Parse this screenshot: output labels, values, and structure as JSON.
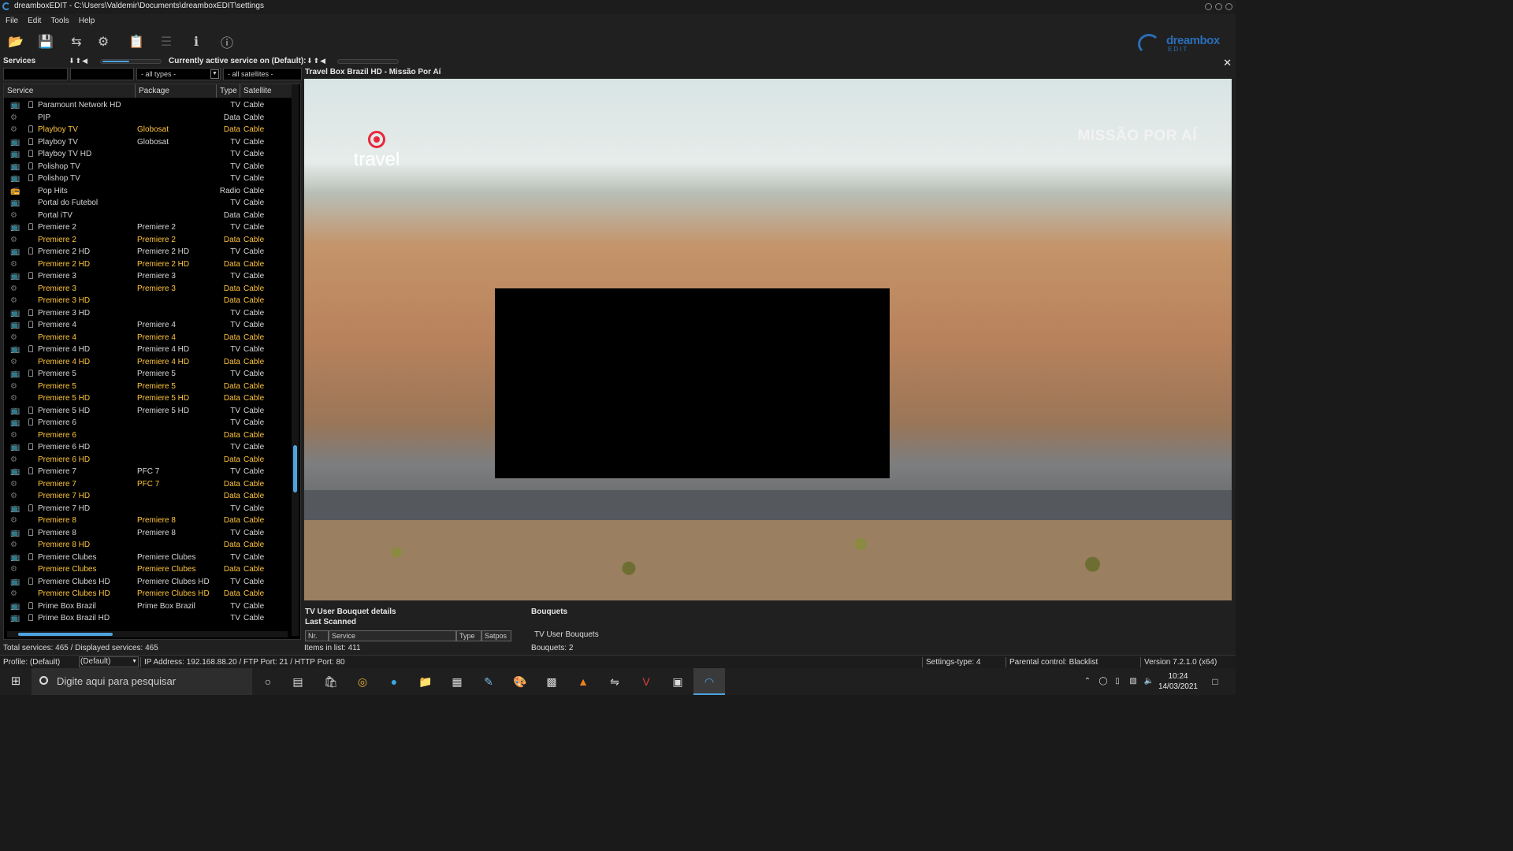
{
  "window": {
    "title": "dreamboxEDIT - C:\\Users\\Valdemir\\Documents\\dreamboxEDIT\\settings"
  },
  "menu": [
    "File",
    "Edit",
    "Tools",
    "Help"
  ],
  "brand": {
    "line1": "dreambox",
    "line2": "EDIT"
  },
  "services_panel": {
    "title": "Services",
    "active_label": "Currently active service on (Default):",
    "filter_types": "- all types -",
    "filter_sats": "- all satellites -",
    "columns": [
      "Service",
      "Package",
      "Type",
      "Satellite"
    ],
    "rows": [
      {
        "name": "Paramount Network HD",
        "package": "",
        "type": "TV",
        "satellite": "Cable",
        "hl": false,
        "lock": true,
        "icon": "tv"
      },
      {
        "name": "PIP",
        "package": "",
        "type": "Data",
        "satellite": "Cable",
        "hl": false,
        "lock": false,
        "icon": "data"
      },
      {
        "name": "Playboy TV",
        "package": "Globosat",
        "type": "Data",
        "satellite": "Cable",
        "hl": true,
        "lock": true,
        "icon": "data"
      },
      {
        "name": "Playboy TV",
        "package": "Globosat",
        "type": "TV",
        "satellite": "Cable",
        "hl": false,
        "lock": true,
        "icon": "tv"
      },
      {
        "name": "Playboy TV HD",
        "package": "",
        "type": "TV",
        "satellite": "Cable",
        "hl": false,
        "lock": true,
        "icon": "tv"
      },
      {
        "name": "Polishop TV",
        "package": "",
        "type": "TV",
        "satellite": "Cable",
        "hl": false,
        "lock": true,
        "icon": "tv"
      },
      {
        "name": "Polishop TV",
        "package": "",
        "type": "TV",
        "satellite": "Cable",
        "hl": false,
        "lock": true,
        "icon": "tv"
      },
      {
        "name": "Pop Hits",
        "package": "",
        "type": "Radio",
        "satellite": "Cable",
        "hl": false,
        "lock": false,
        "icon": "radio"
      },
      {
        "name": "Portal do Futebol",
        "package": "",
        "type": "TV",
        "satellite": "Cable",
        "hl": false,
        "lock": false,
        "icon": "tv"
      },
      {
        "name": "Portal iTV",
        "package": "",
        "type": "Data",
        "satellite": "Cable",
        "hl": false,
        "lock": false,
        "icon": "data"
      },
      {
        "name": "Premiere 2",
        "package": "Premiere 2",
        "type": "TV",
        "satellite": "Cable",
        "hl": false,
        "lock": true,
        "icon": "tv"
      },
      {
        "name": "Premiere 2",
        "package": "Premiere 2",
        "type": "Data",
        "satellite": "Cable",
        "hl": true,
        "lock": false,
        "icon": "data"
      },
      {
        "name": "Premiere 2 HD",
        "package": "Premiere 2 HD",
        "type": "TV",
        "satellite": "Cable",
        "hl": false,
        "lock": true,
        "icon": "tv"
      },
      {
        "name": "Premiere 2 HD",
        "package": "Premiere 2 HD",
        "type": "Data",
        "satellite": "Cable",
        "hl": true,
        "lock": false,
        "icon": "data"
      },
      {
        "name": "Premiere 3",
        "package": "Premiere 3",
        "type": "TV",
        "satellite": "Cable",
        "hl": false,
        "lock": true,
        "icon": "tv"
      },
      {
        "name": "Premiere 3",
        "package": "Premiere 3",
        "type": "Data",
        "satellite": "Cable",
        "hl": true,
        "lock": false,
        "icon": "data"
      },
      {
        "name": "Premiere 3 HD",
        "package": "",
        "type": "Data",
        "satellite": "Cable",
        "hl": true,
        "lock": false,
        "icon": "data"
      },
      {
        "name": "Premiere 3 HD",
        "package": "",
        "type": "TV",
        "satellite": "Cable",
        "hl": false,
        "lock": true,
        "icon": "tv"
      },
      {
        "name": "Premiere 4",
        "package": "Premiere 4",
        "type": "TV",
        "satellite": "Cable",
        "hl": false,
        "lock": true,
        "icon": "tv"
      },
      {
        "name": "Premiere 4",
        "package": "Premiere 4",
        "type": "Data",
        "satellite": "Cable",
        "hl": true,
        "lock": false,
        "icon": "data"
      },
      {
        "name": "Premiere 4 HD",
        "package": "Premiere 4 HD",
        "type": "TV",
        "satellite": "Cable",
        "hl": false,
        "lock": true,
        "icon": "tv"
      },
      {
        "name": "Premiere 4 HD",
        "package": "Premiere 4 HD",
        "type": "Data",
        "satellite": "Cable",
        "hl": true,
        "lock": false,
        "icon": "data"
      },
      {
        "name": "Premiere 5",
        "package": "Premiere 5",
        "type": "TV",
        "satellite": "Cable",
        "hl": false,
        "lock": true,
        "icon": "tv"
      },
      {
        "name": "Premiere 5",
        "package": "Premiere 5",
        "type": "Data",
        "satellite": "Cable",
        "hl": true,
        "lock": false,
        "icon": "data"
      },
      {
        "name": "Premiere 5 HD",
        "package": "Premiere 5 HD",
        "type": "Data",
        "satellite": "Cable",
        "hl": true,
        "lock": false,
        "icon": "data"
      },
      {
        "name": "Premiere 5 HD",
        "package": "Premiere 5 HD",
        "type": "TV",
        "satellite": "Cable",
        "hl": false,
        "lock": true,
        "icon": "tv"
      },
      {
        "name": "Premiere 6",
        "package": "",
        "type": "TV",
        "satellite": "Cable",
        "hl": false,
        "lock": true,
        "icon": "tv"
      },
      {
        "name": "Premiere 6",
        "package": "",
        "type": "Data",
        "satellite": "Cable",
        "hl": true,
        "lock": false,
        "icon": "data"
      },
      {
        "name": "Premiere 6 HD",
        "package": "",
        "type": "TV",
        "satellite": "Cable",
        "hl": false,
        "lock": true,
        "icon": "tv"
      },
      {
        "name": "Premiere 6 HD",
        "package": "",
        "type": "Data",
        "satellite": "Cable",
        "hl": true,
        "lock": false,
        "icon": "data"
      },
      {
        "name": "Premiere 7",
        "package": "PFC 7",
        "type": "TV",
        "satellite": "Cable",
        "hl": false,
        "lock": true,
        "icon": "tv"
      },
      {
        "name": "Premiere 7",
        "package": "PFC 7",
        "type": "Data",
        "satellite": "Cable",
        "hl": true,
        "lock": false,
        "icon": "data"
      },
      {
        "name": "Premiere 7 HD",
        "package": "",
        "type": "Data",
        "satellite": "Cable",
        "hl": true,
        "lock": false,
        "icon": "data"
      },
      {
        "name": "Premiere 7 HD",
        "package": "",
        "type": "TV",
        "satellite": "Cable",
        "hl": false,
        "lock": true,
        "icon": "tv"
      },
      {
        "name": "Premiere 8",
        "package": "Premiere 8",
        "type": "Data",
        "satellite": "Cable",
        "hl": true,
        "lock": false,
        "icon": "data"
      },
      {
        "name": "Premiere 8",
        "package": "Premiere 8",
        "type": "TV",
        "satellite": "Cable",
        "hl": false,
        "lock": true,
        "icon": "tv"
      },
      {
        "name": "Premiere 8 HD",
        "package": "",
        "type": "Data",
        "satellite": "Cable",
        "hl": true,
        "lock": false,
        "icon": "data"
      },
      {
        "name": "Premiere Clubes",
        "package": "Premiere Clubes",
        "type": "TV",
        "satellite": "Cable",
        "hl": false,
        "lock": true,
        "icon": "tv"
      },
      {
        "name": "Premiere Clubes",
        "package": "Premiere Clubes",
        "type": "Data",
        "satellite": "Cable",
        "hl": true,
        "lock": false,
        "icon": "data"
      },
      {
        "name": "Premiere Clubes HD",
        "package": "Premiere Clubes HD",
        "type": "TV",
        "satellite": "Cable",
        "hl": false,
        "lock": true,
        "icon": "tv"
      },
      {
        "name": "Premiere Clubes HD",
        "package": "Premiere Clubes HD",
        "type": "Data",
        "satellite": "Cable",
        "hl": true,
        "lock": false,
        "icon": "data"
      },
      {
        "name": "Prime Box Brazil",
        "package": "Prime Box Brazil",
        "type": "TV",
        "satellite": "Cable",
        "hl": false,
        "lock": true,
        "icon": "tv"
      },
      {
        "name": "Prime Box Brazil HD",
        "package": "",
        "type": "TV",
        "satellite": "Cable",
        "hl": false,
        "lock": true,
        "icon": "tv"
      }
    ]
  },
  "player": {
    "title": "Travel Box Brazil HD - Missão Por Aí",
    "logo_text": "travel",
    "caption": "MISSÃO POR AÍ"
  },
  "bouquet_details": {
    "title": "TV User Bouquet details",
    "subtitle": "Last Scanned",
    "columns": [
      "Nr.",
      "Service",
      "Type",
      "Satpos"
    ],
    "items": "Items in list: 411"
  },
  "bouquets": {
    "title": "Bouquets",
    "item": "TV User Bouquets",
    "count": "Bouquets: 2"
  },
  "status": {
    "totals": "Total services: 465  /  Displayed services: 465",
    "profile": "Profile: (Default)",
    "profile_select": "(Default)",
    "ip": "IP Address: 192.168.88.20 / FTP Port: 21 / HTTP Port: 80",
    "settings_type": "Settings-type: 4",
    "parental": "Parental control: Blacklist",
    "version": "Version 7.2.1.0 (x64)"
  },
  "taskbar": {
    "search_placeholder": "Digite aqui para pesquisar",
    "time": "10:24",
    "date": "14/03/2021"
  },
  "colors": {
    "highlight": "#ffc53d",
    "accent": "#4da3e0",
    "brand": "#2a6db8"
  }
}
